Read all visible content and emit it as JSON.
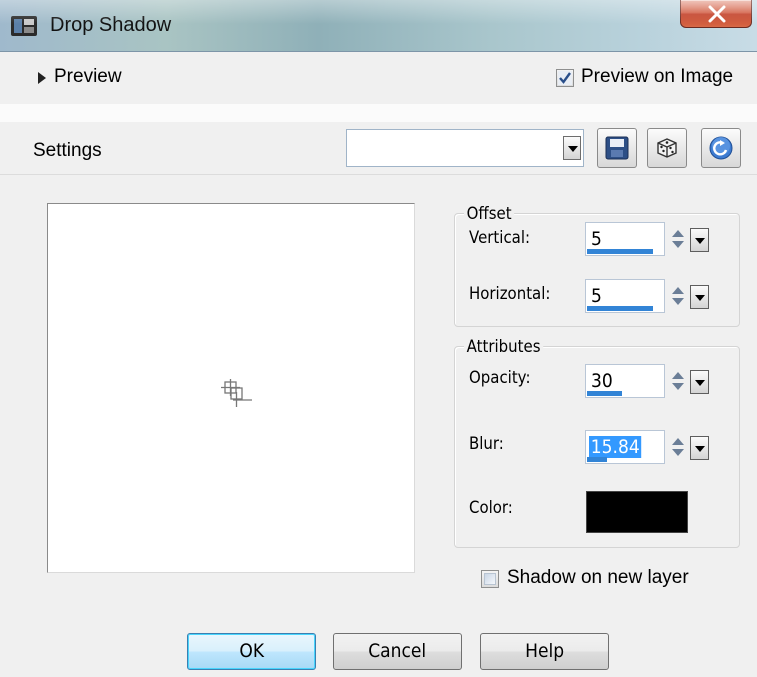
{
  "window": {
    "title": "Drop Shadow",
    "close_symbol": "X"
  },
  "preview": {
    "label": "Preview",
    "preview_on_image_label": "Preview on Image",
    "preview_on_image_checked": true
  },
  "settings": {
    "label": "Settings",
    "value": ""
  },
  "offset": {
    "title": "Offset",
    "vertical": {
      "label": "Vertical:",
      "value": "5",
      "fill": 0.85
    },
    "horizontal": {
      "label": "Horizontal:",
      "value": "5",
      "fill": 0.85
    }
  },
  "attributes": {
    "title": "Attributes",
    "opacity": {
      "label": "Opacity:",
      "value": "30",
      "fill": 0.45
    },
    "blur": {
      "label": "Blur:",
      "value": "15.84",
      "fill": 0.25
    },
    "color": {
      "label": "Color:",
      "value": "#000000"
    }
  },
  "shadow_on_new_layer": {
    "label": "Shadow on new layer",
    "checked": false
  },
  "buttons": {
    "ok": "OK",
    "cancel": "Cancel",
    "help": "Help"
  }
}
